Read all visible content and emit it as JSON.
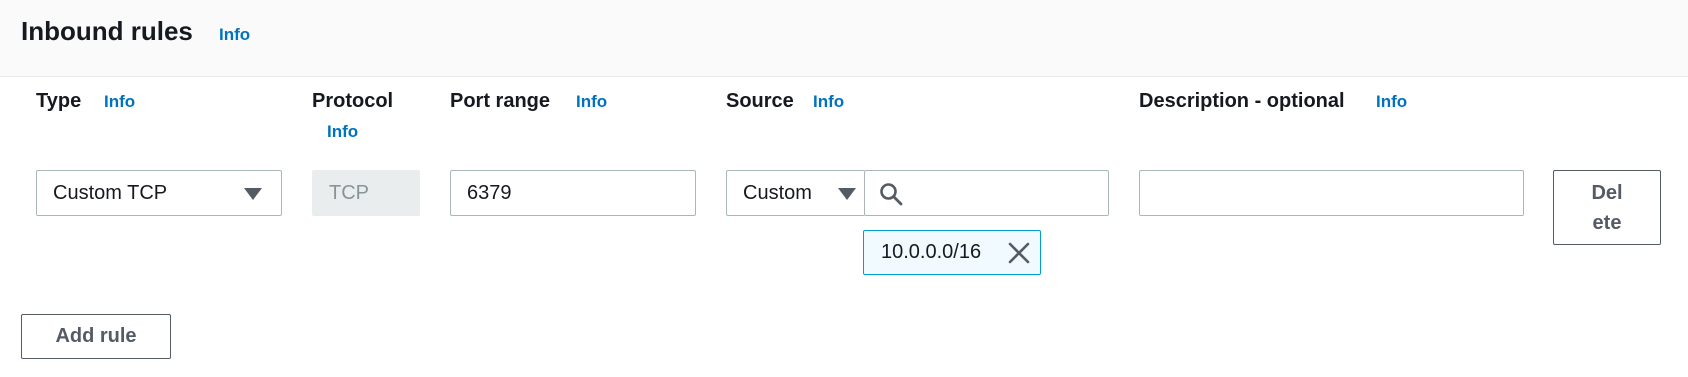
{
  "header": {
    "title": "Inbound rules",
    "info": "Info"
  },
  "columns": {
    "type": {
      "label": "Type",
      "info": "Info"
    },
    "protocol": {
      "label": "Protocol",
      "info": "Info"
    },
    "port_range": {
      "label": "Port range",
      "info": "Info"
    },
    "source": {
      "label": "Source",
      "info": "Info"
    },
    "description": {
      "label": "Description - optional",
      "info": "Info"
    }
  },
  "rule": {
    "type_value": "Custom TCP",
    "protocol_value": "TCP",
    "port_value": "6379",
    "source_mode": "Custom",
    "source_search_value": "",
    "source_token": "10.0.0.0/16",
    "description_value": "",
    "delete_label_line1": "Del",
    "delete_label_line2": "ete"
  },
  "actions": {
    "add_rule": "Add rule"
  },
  "colors": {
    "link": "#0073bb",
    "token_border": "#00a1c9",
    "token_bg": "#f1faff"
  },
  "icons": {
    "search": "search-icon",
    "dropdown": "caret-down-icon",
    "remove": "close-icon"
  }
}
